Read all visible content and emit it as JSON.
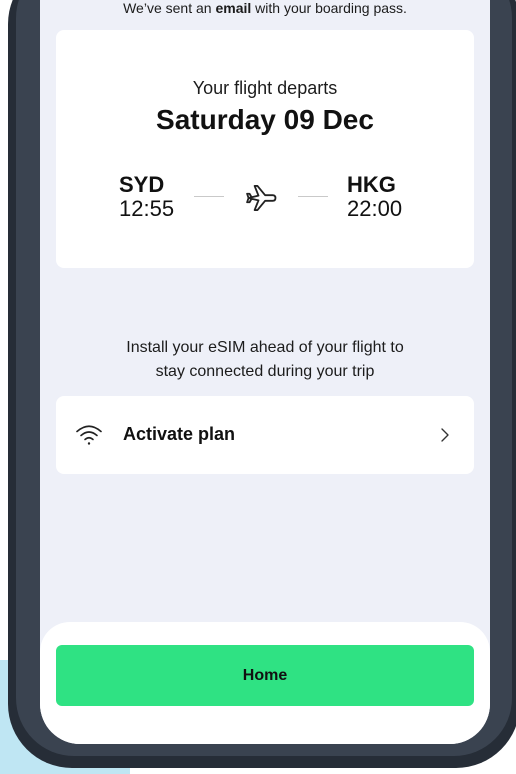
{
  "notice": {
    "prefix": "We’ve sent an ",
    "highlight": "email",
    "suffix": " with your boarding pass."
  },
  "flight": {
    "departs_label": "Your flight departs",
    "date": "Saturday 09 Dec",
    "origin": {
      "code": "SYD",
      "time": "12:55"
    },
    "destination": {
      "code": "HKG",
      "time": "22:00"
    },
    "icon": "plane-icon"
  },
  "esim": {
    "line1": "Install your eSIM ahead of your flight to",
    "line2": "stay connected during your trip"
  },
  "activate": {
    "label": "Activate plan",
    "icon": "wifi-icon",
    "chevron": "chevron-right-icon"
  },
  "footer": {
    "home_label": "Home",
    "accent": "#2fe283"
  },
  "colors": {
    "screen_bg": "#eef0f8",
    "phone_frame": "#262d37",
    "card_bg": "#ffffff"
  }
}
